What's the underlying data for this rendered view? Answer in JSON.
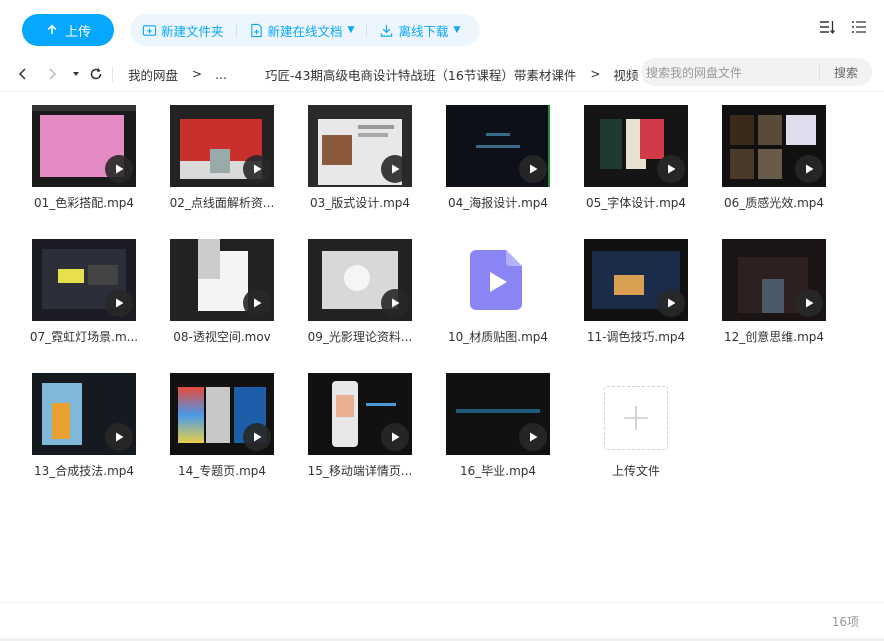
{
  "toolbar": {
    "upload_label": "上传",
    "new_folder_label": "新建文件夹",
    "new_online_doc_label": "新建在线文档",
    "offline_download_label": "离线下载"
  },
  "nav": {
    "breadcrumb": [
      "我的网盘",
      "...",
      "巧匠-43期高级电商设计特战班（16节课程）带素材课件",
      "视频"
    ],
    "search_placeholder": "搜索我的网盘文件",
    "search_button": "搜索"
  },
  "files": [
    {
      "name": "01_色彩搭配.mp4"
    },
    {
      "name": "02_点线面解析资..."
    },
    {
      "name": "03_版式设计.mp4"
    },
    {
      "name": "04_海报设计.mp4"
    },
    {
      "name": "05_字体设计.mp4"
    },
    {
      "name": "06_质感光效.mp4"
    },
    {
      "name": "07_霓虹灯场景.m..."
    },
    {
      "name": "08-透视空间.mov"
    },
    {
      "name": "09_光影理论资料..."
    },
    {
      "name": "10_材质贴图.mp4"
    },
    {
      "name": "11-调色技巧.mp4"
    },
    {
      "name": "12_创意思维.mp4"
    },
    {
      "name": "13_合成技法.mp4"
    },
    {
      "name": "14_专题页.mp4"
    },
    {
      "name": "15_移动端详情页..."
    },
    {
      "name": "16_毕业.mp4"
    }
  ],
  "upload_tile_label": "上传文件",
  "footer": {
    "count": "16项"
  },
  "colors": {
    "accent": "#06a7ff",
    "video_icon": "#7b7cf6"
  }
}
